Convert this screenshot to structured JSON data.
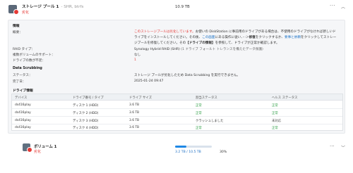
{
  "pool": {
    "title": "ストレージ プール 1",
    "subtitle": "- SHR, btrfs",
    "status": "劣化",
    "size": "10.9 TB",
    "more": "···",
    "collapse": "︿"
  },
  "info": {
    "section_title": "情報",
    "summary_label": "概要：",
    "summary_parts": [
      "このストレージプールは劣化しています。",
      "お使いの DiskStation に事前用のドライブがある場合は、",
      "不使用のドライブがなければ新しいドライブをインストールしてください。その後、",
      "この画面",
      "にある操作に従い、",
      "···",
      "＞",
      "修復",
      "をクリックするか、",
      "要事と依頼",
      "をクリックしてストレージプールを修復してください。その",
      "【ドライブの情報】",
      "を参照して、ドライブが正常か確認します。"
    ],
    "raid_label": "RAID タイプ：",
    "raid_value": "Synology Hybrid RAID (SHR)",
    "raid_note": "(1 ドライブ フォールト トレランスを備えたデータ保護)",
    "multi_label": "複数ボリュームのサポート：",
    "multi_value": "なし",
    "missing_label": "ドライブの数が不足：",
    "missing_value": "1"
  },
  "scrub": {
    "section_title": "Data Scrubbing",
    "status_label": "ステータス：",
    "status_value": "ストレージ プールが劣化したため Data Scrubbing を実行できません。",
    "done_label": "完了日：",
    "done_value": "2025-01-24 09:47"
  },
  "drives": {
    "section_title": "ドライブ情報",
    "headers": [
      "デバイス",
      "ドライブ番号 / タイプ",
      "ドライブ サイズ",
      "割当ステータス",
      "ヘルス ステータス"
    ],
    "rows": [
      {
        "device": "ds416play",
        "slot": "ディスク 1 (HDD)",
        "size": "3.6 TB",
        "alloc": "正常",
        "health": "正常"
      },
      {
        "device": "ds416play",
        "slot": "ディスク 2 (HDD)",
        "size": "3.6 TB",
        "alloc": "正常",
        "health": "正常"
      },
      {
        "device": "ds416play",
        "slot": "ディスク 3 (HDD)",
        "size": "3.6 TB",
        "alloc": "クラッシュしました",
        "health": "未対応"
      },
      {
        "device": "ds416play",
        "slot": "ディスク 4 (HDD)",
        "size": "3.6 TB",
        "alloc": "正常",
        "health": "正常"
      }
    ]
  },
  "volume": {
    "title": "ボリューム 1",
    "status": "劣化",
    "usage_text": "3.2 TB / 10.5 TB",
    "usage_percent": "30%",
    "usage_fraction": 0.3,
    "more": "···",
    "chevron": "﹀"
  },
  "colors": {
    "accent": "#1e88e5",
    "error": "#e53935",
    "ok": "#2e9e45"
  }
}
